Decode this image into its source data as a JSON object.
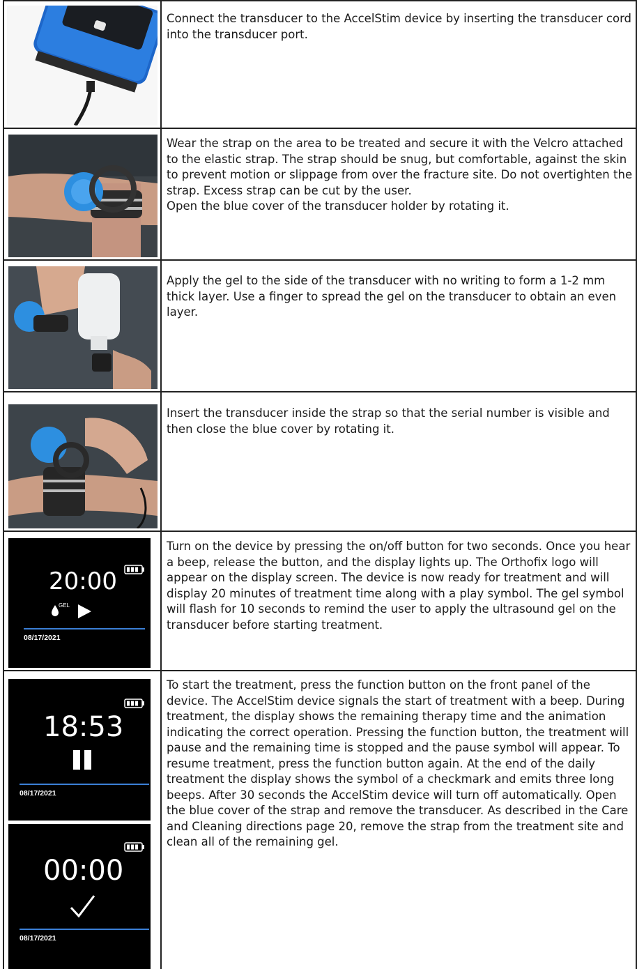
{
  "rows": [
    {
      "image": "device-transducer-photo",
      "text": [
        "Connect the transducer to the AccelStim device by inserting the transducer cord into the transducer port."
      ]
    },
    {
      "image": "strap-on-arm-photo",
      "text": [
        "Wear the strap on the area to be treated and secure it with the Velcro attached to the elastic strap. The strap should be snug, but comfortable, against the skin to prevent motion or slippage from over the fracture site.  Do not overtighten the strap.  Excess strap can be cut by the user.",
        "Open the blue cover of the transducer holder by rotating it."
      ]
    },
    {
      "image": "apply-gel-photo",
      "text": [
        "Apply the gel to the side of the transducer with no writing to form a 1-2 mm thick layer. Use a finger to spread the gel on the transducer to obtain an even layer."
      ]
    },
    {
      "image": "insert-transducer-photo",
      "text": [
        "Insert the transducer inside the strap so that the serial number is visible and then close the blue cover by rotating it."
      ]
    },
    {
      "image": "screen-ready",
      "screen": {
        "time": "20:00",
        "gel_label": "GEL",
        "date": "08/17/2021"
      },
      "text": [
        "Turn on the device by pressing the on/off button for two seconds. Once you hear a beep, release the button, and the display lights up. The Orthofix logo will appear on the display screen. The device is now ready for treatment and will display 20 minutes of treatment time along with a play symbol. The gel symbol will flash for 10 seconds to remind the user to apply the ultrasound gel on the transducer before starting treatment."
      ]
    },
    {
      "image": "screen-pause-and-complete",
      "screens": [
        {
          "time": "18:53",
          "date": "08/17/2021"
        },
        {
          "time": "00:00",
          "date": "08/17/2021"
        }
      ],
      "text": [
        "To start the treatment, press the function button on the front panel of the device. The AccelStim device signals the start of treatment with a beep. During treatment, the display shows the remaining therapy time and the animation indicating the correct operation. Pressing the function button, the treatment will pause and the remaining time is stopped and the pause symbol will appear. To resume treatment, press the function button again. At the end of the daily treatment the display shows the symbol of a checkmark and emits three long beeps. After 30 seconds the AccelStim device will turn off automatically. Open the blue cover of the strap and remove the transducer. As described in the Care and Cleaning directions  page 20, remove the strap from the treatment site and clean all of the remaining gel."
      ]
    }
  ],
  "colors": {
    "accent_blue": "#3b8fe0",
    "screen_line": "#3b7fd6",
    "border": "#222222"
  }
}
